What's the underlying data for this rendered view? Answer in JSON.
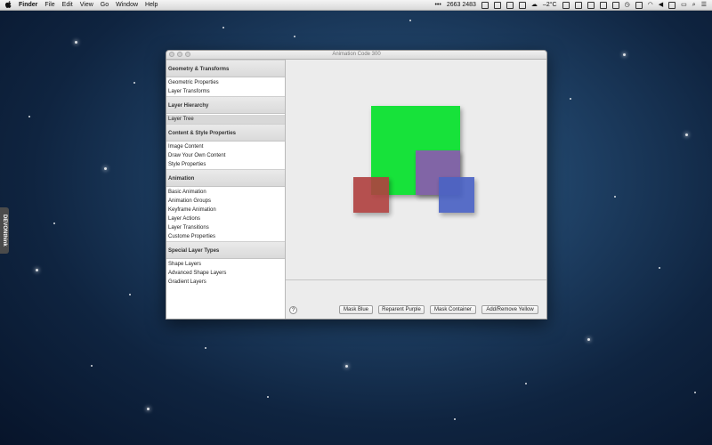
{
  "menubar": {
    "app_name": "Finder",
    "menus": [
      "File",
      "Edit",
      "View",
      "Go",
      "Window",
      "Help"
    ],
    "status": {
      "dots": "•••",
      "counter": "2663 2483",
      "weather": "–2°C"
    }
  },
  "side_tab": {
    "label": "DEVONthink"
  },
  "window": {
    "title": "Animation Code 300",
    "sidebar": {
      "sections": [
        {
          "title": "Geometry & Transforms",
          "items": [
            "Geometric Properties",
            "Layer Transforms"
          ]
        },
        {
          "title": "Layer Hierarchy",
          "items": [
            "Layer Tree"
          ]
        },
        {
          "title": "Content & Style Properties",
          "items": [
            "Image Content",
            "Draw Your Own Content",
            "Style Properties"
          ]
        },
        {
          "title": "Animation",
          "items": [
            "Basic Animation",
            "Animation Groups",
            "Keyframe Animation",
            "Layer Actions",
            "Layer Transitions",
            "Custome Properties"
          ]
        },
        {
          "title": "Special Layer Types",
          "items": [
            "Shape Layers",
            "Advanced Shape Layers",
            "Gradient Layers"
          ]
        }
      ],
      "selected_item": "Layer Tree"
    },
    "canvas": {
      "layers": [
        {
          "name": "green-layer",
          "color": "#17e23a"
        },
        {
          "name": "red-layer",
          "color": "#b0403f"
        },
        {
          "name": "purple-layer",
          "color": "#8a5bb0"
        },
        {
          "name": "blue-layer",
          "color": "#4b63c4"
        }
      ]
    },
    "buttons": {
      "help": "?",
      "mask_blue": "Mask Blue",
      "reparent_purple": "Reparent Purple",
      "mask_container": "Mask Container",
      "add_remove_yellow": "Add/Remove Yellow"
    }
  }
}
